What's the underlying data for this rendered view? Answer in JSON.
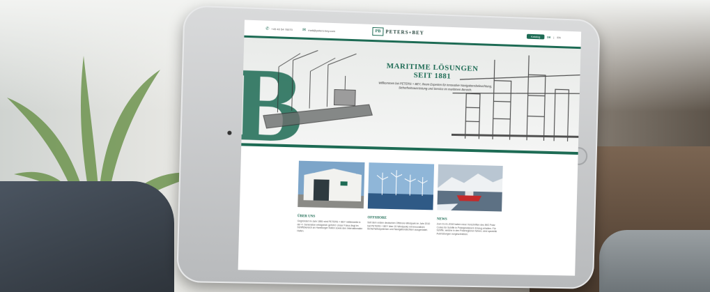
{
  "header": {
    "phone": "+49 40 54 76070",
    "email": "mail@peters-bey.com",
    "logo_mark": "PB",
    "logo_text": "PETERS+BEY",
    "catalog_button": "Katalog",
    "lang_de": "DE",
    "lang_sep": "|",
    "lang_en": "EN"
  },
  "hero": {
    "title_line1": "MARITIME LÖSUNGEN",
    "title_line2": "SEIT 1881",
    "text": "Willkommen bei PETERS + BEY, Ihrem Experten für innovative Navigationsbeleuchtung, Sicherheitsausrüstung und Service im maritimen Bereich.",
    "big_letter": "B"
  },
  "cards": [
    {
      "title": "ÜBER UNS",
      "text": "Gegründet im Jahr 1881 wird PETERS + BEY mittlerweile in der 4. Generation erfolgreich geführt. Unser Fokus liegt im Schiffsbereich an Hamburger Hafen sowie den internationalen Hafen."
    },
    {
      "title": "OFFSHORE",
      "text": "Seit dem ersten deutschen Offshore-Windpark im Jahr 2010 hat PETERS + BEY über 20 Windparks mit innovativen Sicherheitssystemen und Navigationslichtern ausgerüstet."
    },
    {
      "title": "NEWS",
      "text": "Zum 01.01.2018 haben neue Vorschriften des IMO Polar Codes für Schiffe in Polargewässern Einzug erhalten. Für Schiffe, welche in den Polarregionen fahren, sind spezielle Ausrüstungen vorgeschrieben."
    }
  ]
}
